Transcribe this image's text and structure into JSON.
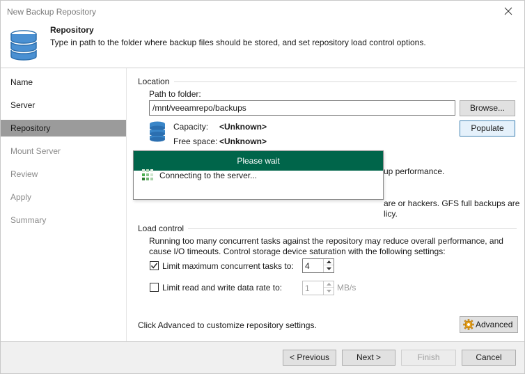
{
  "window": {
    "title": "New Backup Repository"
  },
  "header": {
    "title": "Repository",
    "description": "Type in path to the folder where backup files should be stored, and set repository load control options."
  },
  "sidebar": {
    "items": [
      {
        "label": "Name",
        "state": "normal"
      },
      {
        "label": "Server",
        "state": "normal"
      },
      {
        "label": "Repository",
        "state": "active"
      },
      {
        "label": "Mount Server",
        "state": "muted"
      },
      {
        "label": "Review",
        "state": "muted"
      },
      {
        "label": "Apply",
        "state": "muted"
      },
      {
        "label": "Summary",
        "state": "muted"
      }
    ]
  },
  "location": {
    "group_label": "Location",
    "path_label": "Path to folder:",
    "path_value": "/mnt/veeamrepo/backups",
    "browse_label": "Browse...",
    "populate_label": "Populate",
    "capacity_label": "Capacity:",
    "capacity_value": "<Unknown>",
    "free_space_label": "Free space:",
    "free_space_value": "<Unknown>"
  },
  "partial_text": {
    "line1": "up performance.",
    "line2": "are or hackers. GFS full backups are",
    "line3": "licy."
  },
  "load_control": {
    "group_label": "Load control",
    "description_line1": "Running too many concurrent tasks against the repository may reduce overall performance, and",
    "description_line2": "cause I/O timeouts. Control storage device saturation with the following settings:",
    "limit_tasks_label": "Limit maximum concurrent tasks to:",
    "limit_tasks_checked": true,
    "limit_tasks_value": "4",
    "limit_rate_label": "Limit read and write data rate to:",
    "limit_rate_checked": false,
    "limit_rate_value": "1",
    "limit_rate_unit": "MB/s"
  },
  "advanced": {
    "hint": "Click Advanced to customize repository settings.",
    "button_label": "Advanced"
  },
  "dialog": {
    "title": "Please wait",
    "message": "Connecting to the server..."
  },
  "footer": {
    "previous_label": "< Previous",
    "next_label": "Next >",
    "finish_label": "Finish",
    "cancel_label": "Cancel"
  },
  "colors": {
    "dialog_header": "#00654a",
    "sidebar_active": "#9b9b9b",
    "db_icon_blue": "#3a86c8",
    "footer_bg": "#f0f0f0"
  }
}
